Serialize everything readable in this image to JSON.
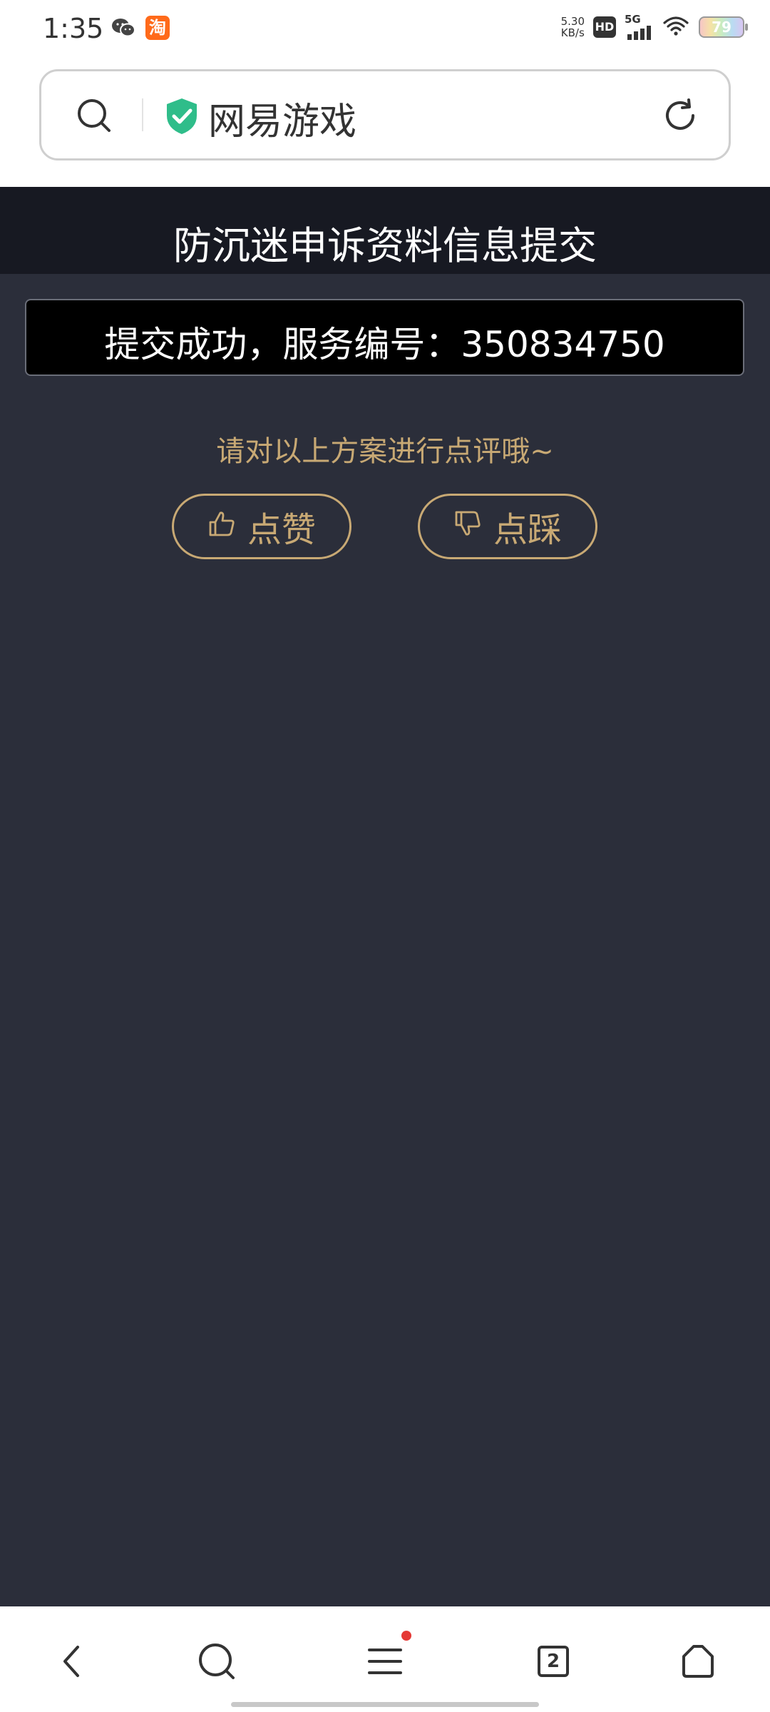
{
  "status_bar": {
    "time": "1:35",
    "net_speed_value": "5.30",
    "net_speed_unit": "KB/s",
    "hd_label": "HD",
    "network_type": "5G",
    "battery_level": "79",
    "left_icons": [
      "wechat-icon",
      "taobao-icon"
    ],
    "taobao_glyph": "淘"
  },
  "address_bar": {
    "site_name": "网易游戏",
    "left_icon": "search-icon",
    "secure_icon": "shield-check-icon",
    "right_icon": "refresh-icon"
  },
  "page": {
    "title": "防沉迷申诉资料信息提交",
    "success_message": "提交成功，服务编号：350834750",
    "rating_prompt": "请对以上方案进行点评哦~",
    "like_label": "点赞",
    "dislike_label": "点踩"
  },
  "bottom_nav": {
    "items": [
      "back-icon",
      "search-icon",
      "menu-icon",
      "tabs-icon",
      "home-icon"
    ],
    "tab_count": "2",
    "menu_has_notification": true
  },
  "colors": {
    "page_background": "#2b2e3a",
    "header_background": "#171922",
    "accent_gold": "#c8a974",
    "secure_green": "#2fbd8a",
    "notification_red": "#e53935"
  }
}
